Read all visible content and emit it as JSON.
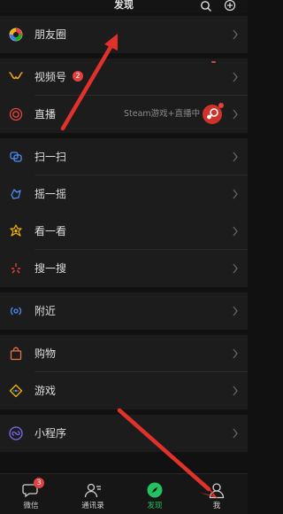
{
  "header": {
    "title": "发现",
    "search_icon": "search-icon",
    "add_icon": "plus-circle-icon"
  },
  "menu": [
    {
      "label": "朋友圈",
      "icon": "moments-icon"
    },
    {
      "label": "视频号",
      "icon": "channels-icon",
      "badge": "2"
    },
    {
      "label": "直播",
      "icon": "live-icon",
      "extra": "Steam游戏+直播中"
    },
    {
      "label": "扫一扫",
      "icon": "scan-icon"
    },
    {
      "label": "摇一摇",
      "icon": "shake-icon"
    },
    {
      "label": "看一看",
      "icon": "top-stories-icon"
    },
    {
      "label": "搜一搜",
      "icon": "search-star-icon"
    },
    {
      "label": "附近",
      "icon": "nearby-icon"
    },
    {
      "label": "购物",
      "icon": "shopping-bag-icon"
    },
    {
      "label": "游戏",
      "icon": "game-icon"
    },
    {
      "label": "小程序",
      "icon": "mini-program-icon"
    }
  ],
  "tabs": [
    {
      "label": "微信",
      "icon": "chat-bubble-icon",
      "badge": "3"
    },
    {
      "label": "通讯录",
      "icon": "contacts-icon"
    },
    {
      "label": "发现",
      "icon": "discover-compass-icon",
      "active": true
    },
    {
      "label": "我",
      "icon": "me-person-icon"
    }
  ],
  "colors": {
    "background": "#111111",
    "row": "#1c1c1c",
    "accent_green": "#23c160",
    "badge_red": "#e24141",
    "arrow_red": "#e0322a"
  }
}
